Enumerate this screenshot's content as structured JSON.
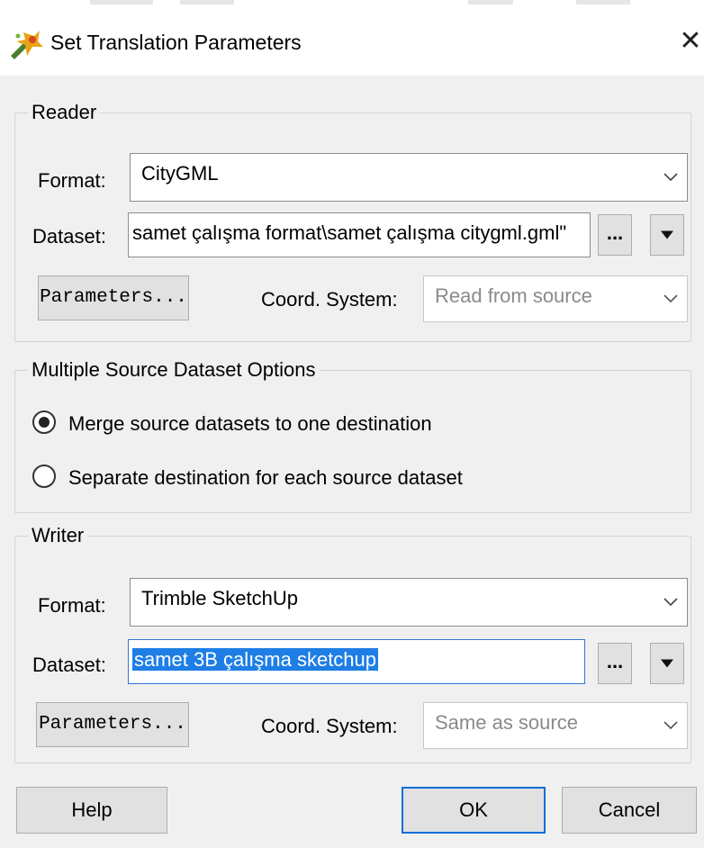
{
  "window": {
    "title": "Set Translation Parameters",
    "close_glyph": "✕"
  },
  "reader": {
    "legend": "Reader",
    "format_label": "Format:",
    "format_value": "CityGML",
    "dataset_label": "Dataset:",
    "dataset_value": "samet çalışma format\\samet çalışma citygml.gml\"",
    "browse_label": "...",
    "parameters_label": "Parameters...",
    "coord_label": "Coord. System:",
    "coord_value": "Read from source"
  },
  "multi_source": {
    "legend": "Multiple Source Dataset Options",
    "options": [
      {
        "label": "Merge source datasets to one destination",
        "checked": true
      },
      {
        "label": "Separate destination for each source dataset",
        "checked": false
      }
    ]
  },
  "writer": {
    "legend": "Writer",
    "format_label": "Format:",
    "format_value": "Trimble SketchUp",
    "dataset_label": "Dataset:",
    "dataset_value": "samet 3B çalışma sketchup",
    "browse_label": "...",
    "parameters_label": "Parameters...",
    "coord_label": "Coord. System:",
    "coord_value": "Same as source"
  },
  "footer": {
    "help_label": "Help",
    "ok_label": "OK",
    "cancel_label": "Cancel"
  },
  "icons": {
    "app": "translation-wand-icon",
    "close": "close-icon",
    "dropdown": "chevron-down-icon",
    "dropdown_arrow": "triangle-down-icon"
  },
  "colors": {
    "selection": "#1e7ee6",
    "default_button_border": "#0a6fd8",
    "client_bg": "#f0f0f0"
  }
}
